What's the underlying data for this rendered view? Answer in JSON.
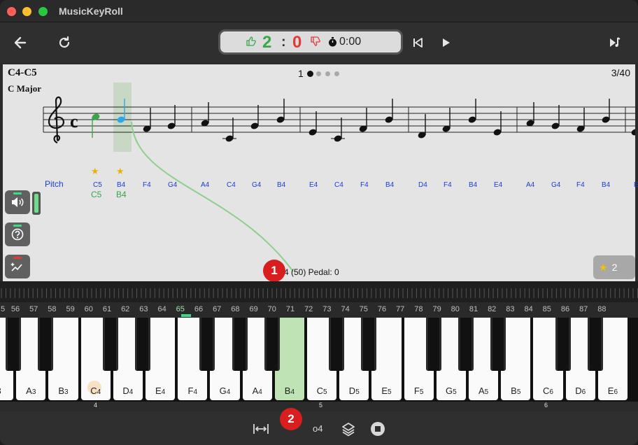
{
  "app": {
    "title": "MusicKeyRoll"
  },
  "score": {
    "good": "2",
    "separator": ":",
    "bad": "0",
    "time": "0:00"
  },
  "sheet": {
    "title": "C4-C5",
    "key": "C Major",
    "page_number": "1",
    "progress": "3/40",
    "pitch_title": "Pitch",
    "pitch_labels": [
      "C5",
      "B4",
      "F4",
      "G4",
      "A4",
      "C4",
      "G4",
      "B4",
      "E4",
      "C4",
      "F4",
      "B4",
      "D4",
      "F4",
      "B4",
      "E4",
      "A4",
      "G4",
      "F4",
      "B4",
      "E"
    ],
    "played_labels": [
      "C5",
      "B4"
    ],
    "note_info": "4 (50)  Pedal: 0",
    "star_count": "2"
  },
  "callouts": {
    "first": "1",
    "second": "2"
  },
  "keyboard": {
    "midi_numbers": [
      "5",
      "56",
      "57",
      "58",
      "59",
      "60",
      "61",
      "62",
      "63",
      "64",
      "65",
      "66",
      "67",
      "68",
      "69",
      "70",
      "71",
      "72",
      "73",
      "74",
      "75",
      "76",
      "77",
      "78",
      "79",
      "80",
      "81",
      "82",
      "83",
      "84",
      "85",
      "86",
      "87",
      "88"
    ],
    "white_keys": [
      {
        "note": "3",
        "sub": ""
      },
      {
        "note": "A",
        "sub": "3"
      },
      {
        "note": "B",
        "sub": "3"
      },
      {
        "note": "C",
        "sub": "4"
      },
      {
        "note": "D",
        "sub": "4"
      },
      {
        "note": "E",
        "sub": "4"
      },
      {
        "note": "F",
        "sub": "4"
      },
      {
        "note": "G",
        "sub": "4"
      },
      {
        "note": "A",
        "sub": "4"
      },
      {
        "note": "B",
        "sub": "4"
      },
      {
        "note": "C",
        "sub": "5"
      },
      {
        "note": "D",
        "sub": "5"
      },
      {
        "note": "E",
        "sub": "5"
      },
      {
        "note": "F",
        "sub": "5"
      },
      {
        "note": "G",
        "sub": "5"
      },
      {
        "note": "A",
        "sub": "5"
      },
      {
        "note": "B",
        "sub": "5"
      },
      {
        "note": "C",
        "sub": "6"
      },
      {
        "note": "D",
        "sub": "6"
      },
      {
        "note": "E",
        "sub": "6"
      }
    ],
    "octave_marks": [
      "4",
      "5",
      "6"
    ],
    "highlighted_key": "B4",
    "highlight_color": "#bfe3b4"
  },
  "bottom": {
    "octave_label": "o4"
  },
  "colors": {
    "good": "#3aa64a",
    "bad": "#e53935",
    "pitch": "#1a3cd6",
    "active_note": "#2aa8e8",
    "played_note": "#3aa64a"
  }
}
